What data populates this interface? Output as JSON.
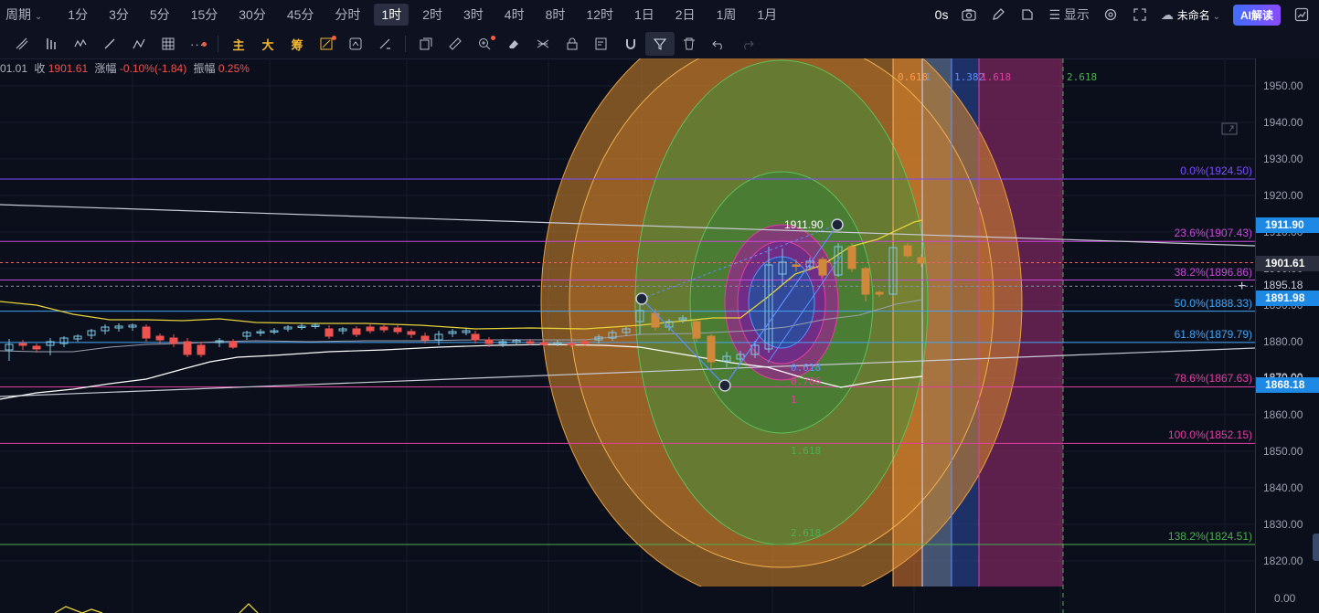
{
  "topbar": {
    "period_label": "周期",
    "intervals": [
      "1分",
      "3分",
      "5分",
      "15分",
      "30分",
      "45分",
      "分时",
      "1时",
      "2时",
      "3时",
      "4时",
      "8时",
      "12时",
      "1日",
      "2日",
      "1周",
      "1月"
    ],
    "active_interval": "1时",
    "countdown": "0s",
    "display_label": "显示",
    "layout_name": "未命名",
    "ai_label": "AI解读"
  },
  "toolbar": {
    "cn_tools": [
      "主",
      "大",
      "筹"
    ]
  },
  "infoline": {
    "open_partial": "01.01",
    "close_label": "收",
    "close_value": "1901.61",
    "change_label": "涨幅",
    "change_value": "-0.10%(-1.84)",
    "amplitude_label": "振幅",
    "amplitude_value": "0.25%"
  },
  "yaxis": {
    "ticks": [
      "1950.00",
      "1940.00",
      "1930.00",
      "1920.00",
      "1910.00",
      "1900.00",
      "1890.00",
      "1880.00",
      "1870.00",
      "1860.00",
      "1850.00",
      "1840.00",
      "1830.00",
      "1820.00"
    ],
    "partial_ticks": [
      "1895.18",
      "1870.00"
    ],
    "bottom_label": "0.00",
    "tags": [
      {
        "text": "1911.90",
        "color": "#1e88e5"
      },
      {
        "text": "1901.61",
        "color": "#2b2f3d"
      },
      {
        "text": "1891.98",
        "color": "#1e88e5"
      },
      {
        "text": "1868.18",
        "color": "#1e88e5"
      }
    ]
  },
  "fib_levels": [
    {
      "label": "0.0%(1924.50)",
      "color": "#7c4dff"
    },
    {
      "label": "23.6%(1907.43)",
      "color": "#c84bd8"
    },
    {
      "label": "38.2%(1896.86)",
      "color": "#c84bd8"
    },
    {
      "label": "50.0%(1888.33)",
      "color": "#42a5f5"
    },
    {
      "label": "61.8%(1879.79)",
      "color": "#42a5f5"
    },
    {
      "label": "78.6%(1867.63)",
      "color": "#e040a0"
    },
    {
      "label": "100.0%(1852.15)",
      "color": "#e040a0"
    },
    {
      "label": "138.2%(1824.51)",
      "color": "#4caf50"
    }
  ],
  "circle_labels": [
    {
      "text": "0.618",
      "color": "#5c8fff"
    },
    {
      "text": "0.786",
      "color": "#e040a0"
    },
    {
      "text": "1",
      "color": "#e040a0"
    },
    {
      "text": "1.618",
      "color": "#4caf50"
    },
    {
      "text": "2.618",
      "color": "#4caf50"
    }
  ],
  "time_zone_labels": [
    {
      "text": "0.618",
      "color": "#ff9a4a"
    },
    {
      "text": "1",
      "color": "#5c8fff"
    },
    {
      "text": "1.382",
      "color": "#5c8fff"
    },
    {
      "text": "1.618",
      "color": "#e040a0"
    },
    {
      "text": "2.618",
      "color": "#4caf50"
    }
  ],
  "high_label": "1911.90",
  "colors": {
    "up": "#26a69a",
    "down": "#ef5350",
    "accent": "#1e88e5"
  }
}
